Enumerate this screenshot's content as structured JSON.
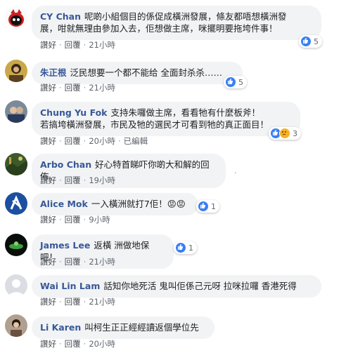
{
  "comments": [
    {
      "author": "CY Chan",
      "text_line1": "呢啲小組個目的係促成橫洲發展，條友都唔想橫洲發",
      "text_line2": "展，咁就無理由參加入去，佢想做主席，咪擺明要拖垮件事！",
      "reactions": [
        "like"
      ],
      "reaction_count": "5",
      "like_label": "讚好",
      "reply_label": "回覆",
      "time": "21小時",
      "edited": ""
    },
    {
      "author": "朱正根",
      "text_line1": "泛民想要一个都不能给 全面封杀杀……",
      "text_line2": "",
      "reactions": [
        "like"
      ],
      "reaction_count": "5",
      "like_label": "讚好",
      "reply_label": "回覆",
      "time": "21小時",
      "edited": ""
    },
    {
      "author": "Chung Yu Fok",
      "text_line1": "支持朱囉做主席，看看牠有什麼板斧！",
      "text_line2": "若搞垮橫洲發展，市民及牠的選民才可看到牠的真正面目！",
      "reactions": [
        "like",
        "sad"
      ],
      "reaction_count": "3",
      "like_label": "讚好",
      "reply_label": "回覆",
      "time": "20小時",
      "edited": "已編輯"
    },
    {
      "author": "Arbo Chan",
      "text_line1": "好心特首睇吓你啲大和解的回佈。",
      "text_line2": "",
      "reactions": [],
      "reaction_count": "",
      "like_label": "讚好",
      "reply_label": "回覆",
      "time": "19小時",
      "edited": ""
    },
    {
      "author": "Alice Mok",
      "text_line1": "一入橫洲就打7佢！😡😡",
      "text_line2": "",
      "reactions": [
        "like"
      ],
      "reaction_count": "1",
      "like_label": "讚好",
      "reply_label": "回覆",
      "time": "9小時",
      "edited": ""
    },
    {
      "author": "James Lee",
      "text_line1": "返橫 洲做地保吧！",
      "text_line2": "",
      "reactions": [
        "like"
      ],
      "reaction_count": "1",
      "like_label": "讚好",
      "reply_label": "回覆",
      "time": "21小時",
      "edited": ""
    },
    {
      "author": "Wai Lin Lam",
      "text_line1": "話知你地死活 鬼叫佢係己元呀 拉咪拉囉 香港死得",
      "text_line2": "",
      "reactions": [],
      "reaction_count": "",
      "like_label": "讚好",
      "reply_label": "回覆",
      "time": "21小時",
      "edited": ""
    },
    {
      "author": "Li Karen",
      "text_line1": "叫柯生正正經經讀返個學位先",
      "text_line2": "",
      "reactions": [],
      "reaction_count": "",
      "like_label": "讚好",
      "reply_label": "回覆",
      "time": "20小時",
      "edited": ""
    }
  ],
  "colors": {
    "author": "#385898",
    "bubble": "#f2f3f5",
    "meta": "#606770",
    "like": "#3b7ff3"
  }
}
